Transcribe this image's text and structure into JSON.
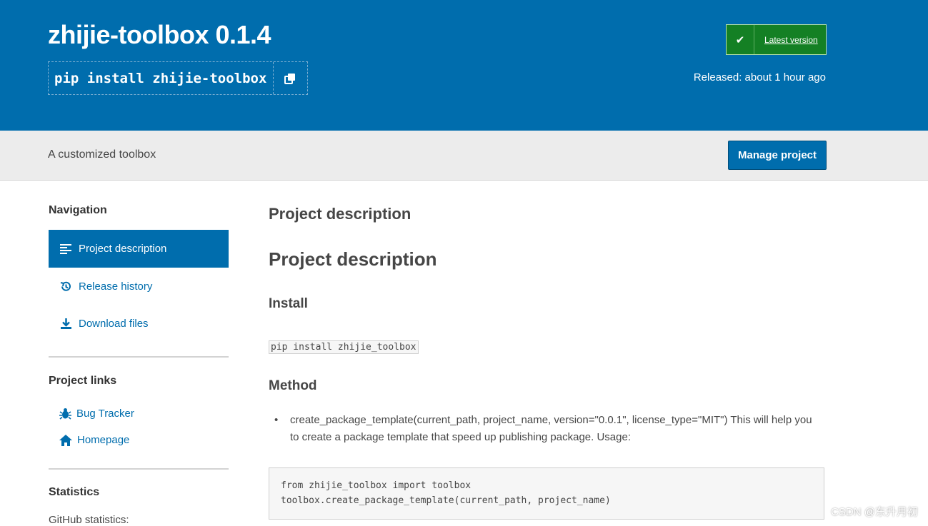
{
  "header": {
    "title": "zhijie-toolbox 0.1.4",
    "pip_command": "pip install zhijie-toolbox",
    "latest_label": "Latest version",
    "released": "Released: about 1 hour ago"
  },
  "subheader": {
    "summary": "A customized toolbox",
    "manage_label": "Manage project"
  },
  "sidebar": {
    "navigation_heading": "Navigation",
    "nav_items": [
      {
        "label": "Project description",
        "icon": "align-left-icon",
        "active": true
      },
      {
        "label": "Release history",
        "icon": "history-icon",
        "active": false
      },
      {
        "label": "Download files",
        "icon": "download-icon",
        "active": false
      }
    ],
    "links_heading": "Project links",
    "links": [
      {
        "label": "Bug Tracker",
        "icon": "bug-icon"
      },
      {
        "label": "Homepage",
        "icon": "home-icon"
      }
    ],
    "statistics_heading": "Statistics",
    "github_stats": "GitHub statistics:"
  },
  "main": {
    "desc_heading": "Project description",
    "desc_heading2": "Project description",
    "install_heading": "Install",
    "install_code": "pip install zhijie_toolbox",
    "method_heading": "Method",
    "method_bullet": "create_package_template(current_path, project_name, version=\"0.0.1\", license_type=\"MIT\") This will help you to create a package template that speed up publishing package. Usage:",
    "code_block": "from zhijie_toolbox import toolbox\ntoolbox.create_package_template(current_path, project_name)"
  },
  "watermark": "CSDN @东升月初",
  "colors": {
    "brand_blue": "#006dad",
    "success_green": "#148024",
    "subheader_gray": "#ececec"
  }
}
